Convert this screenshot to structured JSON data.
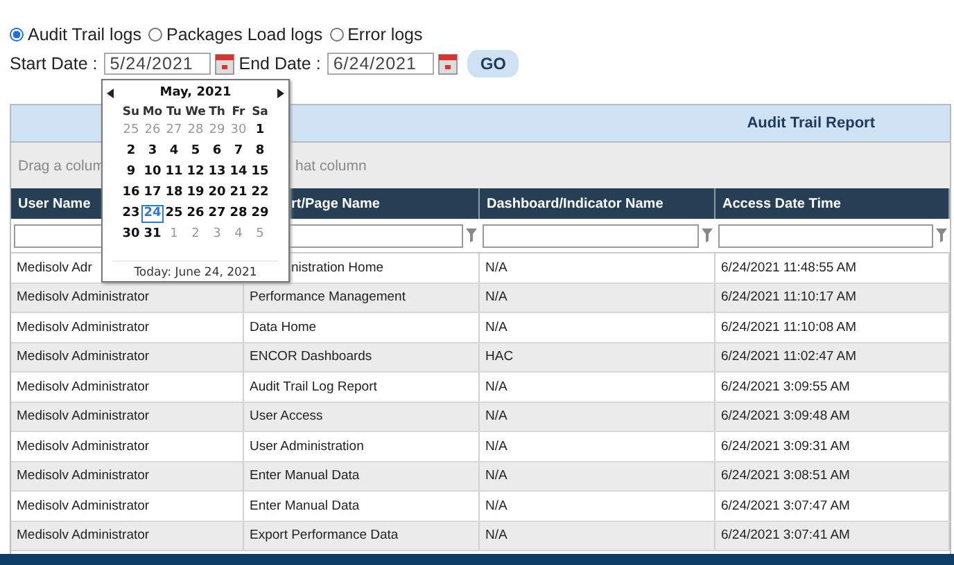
{
  "log_types": [
    {
      "label": "Audit Trail logs",
      "selected": true
    },
    {
      "label": "Packages Load logs",
      "selected": false
    },
    {
      "label": "Error logs",
      "selected": false
    }
  ],
  "start_date": {
    "label": "Start Date :",
    "value": "5/24/2021"
  },
  "end_date": {
    "label": "End Date :",
    "value": "6/24/2021"
  },
  "go_button": "GO",
  "report_title": "Audit Trail Report",
  "group_bar": {
    "left": "Drag a colum",
    "right": "hat column"
  },
  "table": {
    "columns": [
      {
        "label": "User Name",
        "covered": false
      },
      {
        "label": "rt/Page Name",
        "covered": true
      },
      {
        "label": "Dashboard/Indicator Name",
        "covered": false
      },
      {
        "label": "Access Date Time",
        "covered": false
      }
    ],
    "rows": [
      [
        {
          "text": "Medisolv Adr",
          "covered": false
        },
        {
          "text": "nistration Home",
          "covered": true
        },
        {
          "text": "N/A",
          "covered": false
        },
        {
          "text": "6/24/2021 11:48:55 AM",
          "covered": false
        }
      ],
      [
        {
          "text": "Medisolv Administrator",
          "covered": false
        },
        {
          "text": "Performance Management",
          "covered": false
        },
        {
          "text": "N/A",
          "covered": false
        },
        {
          "text": "6/24/2021 11:10:17 AM",
          "covered": false
        }
      ],
      [
        {
          "text": "Medisolv Administrator",
          "covered": false
        },
        {
          "text": "Data Home",
          "covered": false
        },
        {
          "text": "N/A",
          "covered": false
        },
        {
          "text": "6/24/2021 11:10:08 AM",
          "covered": false
        }
      ],
      [
        {
          "text": "Medisolv Administrator",
          "covered": false
        },
        {
          "text": "ENCOR Dashboards",
          "covered": false
        },
        {
          "text": "HAC",
          "covered": false
        },
        {
          "text": "6/24/2021 11:02:47 AM",
          "covered": false
        }
      ],
      [
        {
          "text": "Medisolv Administrator",
          "covered": false
        },
        {
          "text": "Audit Trail Log Report",
          "covered": false
        },
        {
          "text": "N/A",
          "covered": false
        },
        {
          "text": "6/24/2021 3:09:55 AM",
          "covered": false
        }
      ],
      [
        {
          "text": "Medisolv Administrator",
          "covered": false
        },
        {
          "text": "User Access",
          "covered": false
        },
        {
          "text": "N/A",
          "covered": false
        },
        {
          "text": "6/24/2021 3:09:48 AM",
          "covered": false
        }
      ],
      [
        {
          "text": "Medisolv Administrator",
          "covered": false
        },
        {
          "text": "User Administration",
          "covered": false
        },
        {
          "text": "N/A",
          "covered": false
        },
        {
          "text": "6/24/2021 3:09:31 AM",
          "covered": false
        }
      ],
      [
        {
          "text": "Medisolv Administrator",
          "covered": false
        },
        {
          "text": "Enter Manual Data",
          "covered": false
        },
        {
          "text": "N/A",
          "covered": false
        },
        {
          "text": "6/24/2021 3:08:51 AM",
          "covered": false
        }
      ],
      [
        {
          "text": "Medisolv Administrator",
          "covered": false
        },
        {
          "text": "Enter Manual Data",
          "covered": false
        },
        {
          "text": "N/A",
          "covered": false
        },
        {
          "text": "6/24/2021 3:07:47 AM",
          "covered": false
        }
      ],
      [
        {
          "text": "Medisolv Administrator",
          "covered": false
        },
        {
          "text": "Export Performance Data",
          "covered": false
        },
        {
          "text": "N/A",
          "covered": false
        },
        {
          "text": "6/24/2021 3:07:41 AM",
          "covered": false
        }
      ]
    ]
  },
  "calendar": {
    "month": "May, 2021",
    "weekdays": [
      "Su",
      "Mo",
      "Tu",
      "We",
      "Th",
      "Fr",
      "Sa"
    ],
    "weeks": [
      [
        {
          "d": "25",
          "muted": true,
          "selected": false
        },
        {
          "d": "26",
          "muted": true,
          "selected": false
        },
        {
          "d": "27",
          "muted": true,
          "selected": false
        },
        {
          "d": "28",
          "muted": true,
          "selected": false
        },
        {
          "d": "29",
          "muted": true,
          "selected": false
        },
        {
          "d": "30",
          "muted": true,
          "selected": false
        },
        {
          "d": "1",
          "muted": false,
          "selected": false
        }
      ],
      [
        {
          "d": "2",
          "muted": false,
          "selected": false
        },
        {
          "d": "3",
          "muted": false,
          "selected": false
        },
        {
          "d": "4",
          "muted": false,
          "selected": false
        },
        {
          "d": "5",
          "muted": false,
          "selected": false
        },
        {
          "d": "6",
          "muted": false,
          "selected": false
        },
        {
          "d": "7",
          "muted": false,
          "selected": false
        },
        {
          "d": "8",
          "muted": false,
          "selected": false
        }
      ],
      [
        {
          "d": "9",
          "muted": false,
          "selected": false
        },
        {
          "d": "10",
          "muted": false,
          "selected": false
        },
        {
          "d": "11",
          "muted": false,
          "selected": false
        },
        {
          "d": "12",
          "muted": false,
          "selected": false
        },
        {
          "d": "13",
          "muted": false,
          "selected": false
        },
        {
          "d": "14",
          "muted": false,
          "selected": false
        },
        {
          "d": "15",
          "muted": false,
          "selected": false
        }
      ],
      [
        {
          "d": "16",
          "muted": false,
          "selected": false
        },
        {
          "d": "17",
          "muted": false,
          "selected": false
        },
        {
          "d": "18",
          "muted": false,
          "selected": false
        },
        {
          "d": "19",
          "muted": false,
          "selected": false
        },
        {
          "d": "20",
          "muted": false,
          "selected": false
        },
        {
          "d": "21",
          "muted": false,
          "selected": false
        },
        {
          "d": "22",
          "muted": false,
          "selected": false
        }
      ],
      [
        {
          "d": "23",
          "muted": false,
          "selected": false
        },
        {
          "d": "24",
          "muted": false,
          "selected": true
        },
        {
          "d": "25",
          "muted": false,
          "selected": false
        },
        {
          "d": "26",
          "muted": false,
          "selected": false
        },
        {
          "d": "27",
          "muted": false,
          "selected": false
        },
        {
          "d": "28",
          "muted": false,
          "selected": false
        },
        {
          "d": "29",
          "muted": false,
          "selected": false
        }
      ],
      [
        {
          "d": "30",
          "muted": false,
          "selected": false
        },
        {
          "d": "31",
          "muted": false,
          "selected": false
        },
        {
          "d": "1",
          "muted": true,
          "selected": false
        },
        {
          "d": "2",
          "muted": true,
          "selected": false
        },
        {
          "d": "3",
          "muted": true,
          "selected": false
        },
        {
          "d": "4",
          "muted": true,
          "selected": false
        },
        {
          "d": "5",
          "muted": true,
          "selected": false
        }
      ]
    ],
    "today": "Today: June 24, 2021"
  }
}
